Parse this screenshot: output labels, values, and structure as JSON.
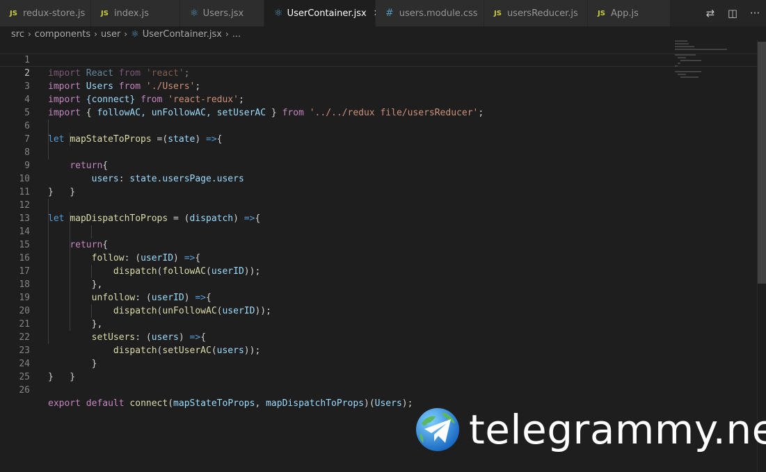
{
  "tabs": [
    {
      "icon": "JS",
      "label": "redux-store.js"
    },
    {
      "icon": "JS",
      "label": "index.js"
    },
    {
      "icon": "react",
      "label": "Users.jsx"
    },
    {
      "icon": "react",
      "label": "UserContainer.jsx",
      "active": true
    },
    {
      "icon": "#",
      "label": "users.module.css"
    },
    {
      "icon": "JS",
      "label": "usersReducer.js"
    },
    {
      "icon": "JS",
      "label": "App.js"
    }
  ],
  "breadcrumbs": [
    "src",
    "components",
    "user",
    "UserContainer.jsx",
    "..."
  ],
  "line_numbers": [
    "1",
    "2",
    "3",
    "4",
    "5",
    "6",
    "7",
    "8",
    "9",
    "10",
    "11",
    "12",
    "13",
    "14",
    "15",
    "16",
    "17",
    "18",
    "19",
    "20",
    "21",
    "22",
    "23",
    "24",
    "25",
    "26"
  ],
  "code": {
    "import": "import",
    "from": "from",
    "react_name": "React",
    "react_str": "'react'",
    "users_name": "Users",
    "users_str": "'./Users'",
    "connect_braces": "{connect}",
    "react_redux_str": "'react-redux'",
    "reducer_imports": "followAC, unFollowAC, setUserAC",
    "reducer_path": "'../../redux file/usersReducer'",
    "let": "let",
    "return": "return",
    "mapState": "mapStateToProps",
    "mapDispatch": "mapDispatchToProps",
    "state": "state",
    "dispatch": "dispatch",
    "users_key": "users",
    "state_path": "state.usersPage.users",
    "follow": "follow",
    "unfollow": "unfollow",
    "setUsers": "setUsers",
    "userID": "userID",
    "followAC": "followAC",
    "unFollowAC": "unFollowAC",
    "setUserAC": "setUserAC",
    "export": "export",
    "default": "default",
    "connect": "connect",
    "Users": "Users"
  },
  "watermark": "telegrammy.net",
  "colors": {
    "editor_bg": "#1e1e1e",
    "tab_bg": "#2d2d2d",
    "keyword": "#c586c0",
    "string": "#ce9178",
    "variable": "#9cdcfe",
    "function": "#dcdcaa",
    "storage": "#569cd6"
  }
}
